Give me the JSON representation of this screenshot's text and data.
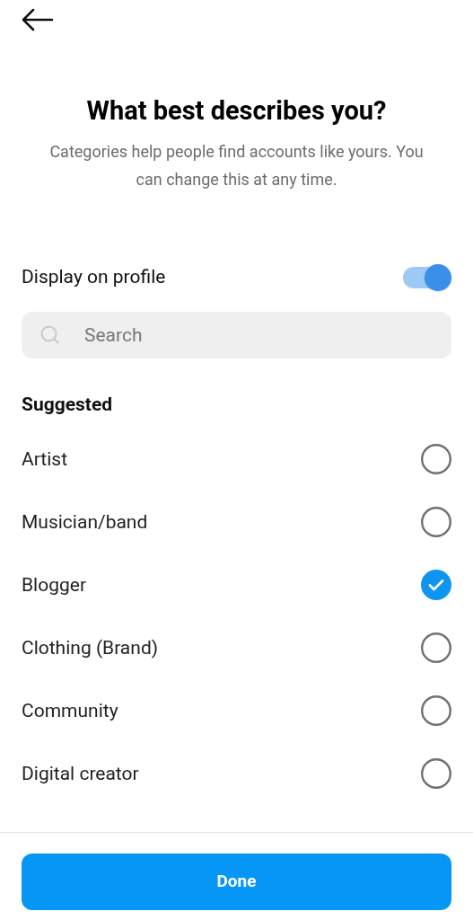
{
  "title": "What best describes you?",
  "subtitle": "Categories help people find accounts like yours. You can change this at any time.",
  "display_on_profile": {
    "label": "Display on profile",
    "on": true
  },
  "search": {
    "placeholder": "Search"
  },
  "section": "Suggested",
  "categories": [
    {
      "label": "Artist",
      "selected": false
    },
    {
      "label": "Musician/band",
      "selected": false
    },
    {
      "label": "Blogger",
      "selected": true
    },
    {
      "label": "Clothing (Brand)",
      "selected": false
    },
    {
      "label": "Community",
      "selected": false
    },
    {
      "label": "Digital creator",
      "selected": false
    }
  ],
  "done_button": "Done"
}
